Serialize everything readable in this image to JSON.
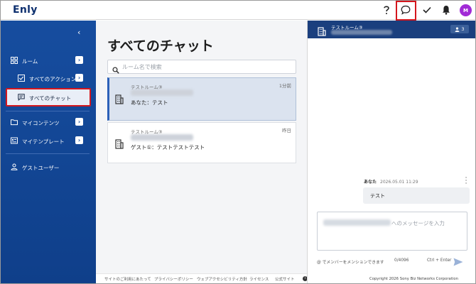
{
  "app": {
    "logo": "Enly"
  },
  "header": {
    "icons": [
      "help-icon",
      "chat-icon",
      "check-icon",
      "bell-icon"
    ],
    "avatar_initial": "M",
    "avatar_color": "#a12bd6",
    "highlight_color": "#d4161d"
  },
  "sidebar": {
    "collapse_glyph": "‹",
    "items": [
      {
        "label": "ルーム",
        "icon": "grid-icon"
      },
      {
        "label": "すべてのアクション",
        "icon": "checkbox-icon"
      },
      {
        "label": "すべてのチャット",
        "icon": "chat-icon",
        "active": true
      },
      {
        "label": "マイコンテンツ",
        "icon": "folder-icon"
      },
      {
        "label": "マイテンプレート",
        "icon": "template-icon"
      },
      {
        "label": "ゲストユーザー",
        "icon": "person-icon"
      }
    ],
    "arrow_glyph": "›"
  },
  "main": {
    "title": "すべてのチャット",
    "search_placeholder": "ルーム名で検索",
    "chats": [
      {
        "room": "テストルーム③",
        "message": "あなた：テスト",
        "time": "1分前",
        "selected": true
      },
      {
        "room": "テストルーム③",
        "message": "ゲスト①：テストテストテスト",
        "time": "昨日",
        "selected": false
      }
    ]
  },
  "footer": {
    "links": [
      "サイトのご利用にあたって",
      "プライバシーポリシー",
      "ウェブアクセシビリティ方針",
      "ライセンス",
      "公式サイト"
    ],
    "info_glyph": "i"
  },
  "chat": {
    "room_name": "テストルーム③",
    "member_count": "3",
    "message": {
      "sender": "あなた",
      "timestamp": "2026.05.01 11:29",
      "text": "テスト"
    },
    "composer_placeholder": "へのメッセージを入力",
    "mention_hint": "@ でメンバーをメンションできます",
    "char_count": "0/4096",
    "shortcut": "Ctrl + Enter",
    "copyright": "Copyright 2026 Sony Biz Networks Corporation"
  }
}
